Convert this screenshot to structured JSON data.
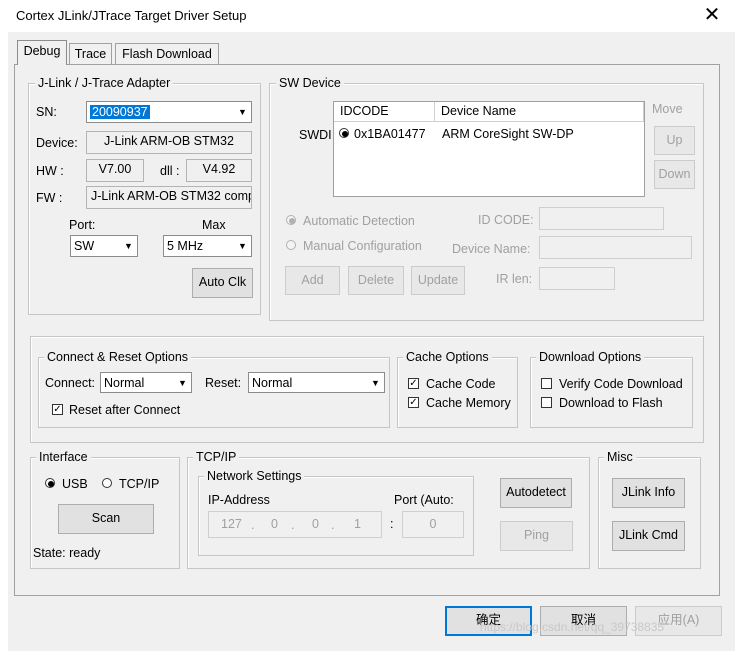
{
  "window": {
    "title": "Cortex JLink/JTrace Target Driver Setup",
    "close_glyph": "✕"
  },
  "tabs": [
    "Debug",
    "Trace",
    "Flash Download"
  ],
  "adapter": {
    "group_label": "J-Link / J-Trace Adapter",
    "sn_label": "SN:",
    "sn_value": "20090937",
    "device_label": "Device:",
    "device_value": "J-Link ARM-OB STM32",
    "hw_label": "HW :",
    "hw_value": "V7.00",
    "dll_label": "dll :",
    "dll_value": "V4.92",
    "fw_label": "FW :",
    "fw_value": "J-Link ARM-OB STM32 comp",
    "port_label": "Port:",
    "port_value": "SW",
    "max_label": "Max",
    "max_value": "5 MHz",
    "autoclk_label": "Auto Clk"
  },
  "sw_device": {
    "group_label": "SW Device",
    "col_idcode": "IDCODE",
    "col_device": "Device Name",
    "row_label": "SWDI",
    "row_idcode": "0x1BA01477",
    "row_device": "ARM CoreSight SW-DP",
    "move_label": "Move",
    "up_label": "Up",
    "down_label": "Down",
    "auto_detect": "Automatic Detection",
    "manual_config": "Manual Configuration",
    "id_code_label": "ID CODE:",
    "device_name_label": "Device Name:",
    "ir_len_label": "IR len:",
    "add_label": "Add",
    "delete_label": "Delete",
    "update_label": "Update"
  },
  "connect_reset": {
    "group_label": "Connect & Reset Options",
    "connect_label": "Connect:",
    "connect_value": "Normal",
    "reset_label": "Reset:",
    "reset_value": "Normal",
    "reset_after_connect": "Reset after Connect"
  },
  "cache": {
    "group_label": "Cache Options",
    "code": "Cache Code",
    "memory": "Cache Memory"
  },
  "download": {
    "group_label": "Download Options",
    "verify": "Verify Code Download",
    "to_flash": "Download to Flash"
  },
  "interface": {
    "group_label": "Interface",
    "usb": "USB",
    "tcpip": "TCP/IP",
    "scan_label": "Scan",
    "state": "State: ready"
  },
  "tcpip": {
    "group_label": "TCP/IP",
    "network_label": "Network Settings",
    "ip_label": "IP-Address",
    "port_label": "Port (Auto:",
    "ip_parts": [
      "127",
      "0",
      "0",
      "1"
    ],
    "port_value": "0",
    "autodetect_label": "Autodetect",
    "ping_label": "Ping"
  },
  "misc": {
    "group_label": "Misc",
    "jlink_info": "JLink Info",
    "jlink_cmd": "JLink Cmd"
  },
  "footer": {
    "ok": "确定",
    "cancel": "取消",
    "apply": "应用(A)"
  },
  "watermark": "https://blog.csdn.net/qq_39738835",
  "colors": {
    "accent": "#0078d7",
    "dialog_bg": "#f0f0f0",
    "disabled_text": "#a0a0a0"
  }
}
